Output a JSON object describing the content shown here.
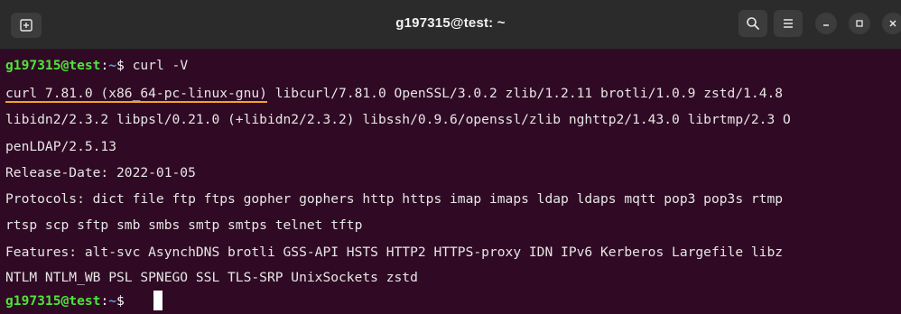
{
  "window": {
    "title": "g197315@test: ~"
  },
  "titlebar": {
    "icons": [
      "new-tab-icon",
      "search-icon",
      "hamburger-menu-icon",
      "minimize-icon",
      "maximize-icon",
      "close-icon"
    ]
  },
  "terminal": {
    "prompt1": {
      "user_host": "g197315@test",
      "colon": ":",
      "path": "~",
      "dollar": "$ ",
      "command": "curl -V"
    },
    "output": {
      "version_highlight": "curl 7.81.0 (x86_64-pc-linux-gnu)",
      "version_rest": " libcurl/7.81.0 OpenSSL/3.0.2 zlib/1.2.11 brotli/1.0.9 zstd/1.4.8",
      "line2": "libidn2/2.3.2 libpsl/0.21.0 (+libidn2/2.3.2) libssh/0.9.6/openssl/zlib nghttp2/1.43.0 librtmp/2.3 O",
      "line3": "penLDAP/2.5.13",
      "line4": "Release-Date: 2022-01-05",
      "line5": "Protocols: dict file ftp ftps gopher gophers http https imap imaps ldap ldaps mqtt pop3 pop3s rtmp",
      "line6": "rtsp scp sftp smb smbs smtp smtps telnet tftp",
      "line7": "Features: alt-svc AsynchDNS brotli GSS-API HSTS HTTP2 HTTPS-proxy IDN IPv6 Kerberos Largefile libz",
      "line8": "NTLM NTLM_WB PSL SPNEGO SSL TLS-SRP UnixSockets zstd"
    },
    "prompt2": {
      "user_host": "g197315@test",
      "colon": ":",
      "path": "~",
      "dollar": "$ "
    }
  },
  "colors": {
    "titlebar_bg": "#2b2b2b",
    "terminal_bg": "#300a24",
    "prompt_user": "#4fe43a",
    "prompt_path": "#5ea1f0",
    "text": "#e6e6e6",
    "highlight_underline": "#f0a326"
  }
}
